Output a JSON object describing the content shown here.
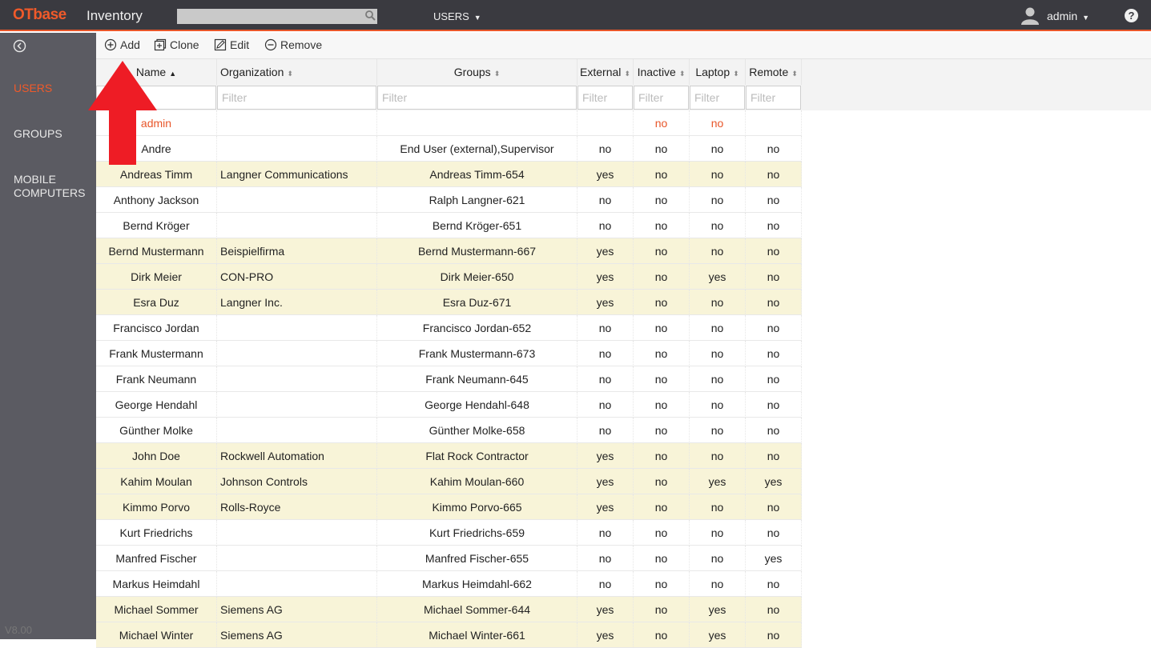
{
  "header": {
    "brand_ot": "OT",
    "brand_base": "base",
    "app_title": "Inventory",
    "search_placeholder": "",
    "menu_label": "USERS",
    "user_label": "admin",
    "help_label": "?"
  },
  "sidebar": {
    "items": [
      {
        "label": "USERS",
        "active": true
      },
      {
        "label": "GROUPS",
        "active": false
      },
      {
        "label": "MOBILE\nCOMPUTERS",
        "active": false
      }
    ],
    "version": "V8.00"
  },
  "toolbar": {
    "add": "Add",
    "clone": "Clone",
    "edit": "Edit",
    "remove": "Remove"
  },
  "table": {
    "columns": [
      {
        "label": "Name",
        "sort": "asc"
      },
      {
        "label": "Organization",
        "sort": "none"
      },
      {
        "label": "Groups",
        "sort": "none"
      },
      {
        "label": "External",
        "sort": "none"
      },
      {
        "label": "Inactive",
        "sort": "none"
      },
      {
        "label": "Laptop",
        "sort": "none"
      },
      {
        "label": "Remote",
        "sort": "none"
      }
    ],
    "filter_placeholder": "Filter",
    "rows": [
      {
        "name": "admin",
        "org": "",
        "groups": "",
        "external": "",
        "inactive": "no",
        "laptop": "no",
        "remote": "",
        "highlight": "red"
      },
      {
        "name": "Andre",
        "org": "",
        "groups": "End User (external),Supervisor",
        "external": "no",
        "inactive": "no",
        "laptop": "no",
        "remote": "no"
      },
      {
        "name": "Andreas Timm",
        "org": "Langner Communications",
        "groups": "Andreas Timm-654",
        "external": "yes",
        "inactive": "no",
        "laptop": "no",
        "remote": "no"
      },
      {
        "name": "Anthony Jackson",
        "org": "",
        "groups": "Ralph Langner-621",
        "external": "no",
        "inactive": "no",
        "laptop": "no",
        "remote": "no"
      },
      {
        "name": "Bernd Kröger",
        "org": "",
        "groups": "Bernd Kröger-651",
        "external": "no",
        "inactive": "no",
        "laptop": "no",
        "remote": "no"
      },
      {
        "name": "Bernd Mustermann",
        "org": "Beispielfirma",
        "groups": "Bernd Mustermann-667",
        "external": "yes",
        "inactive": "no",
        "laptop": "no",
        "remote": "no"
      },
      {
        "name": "Dirk Meier",
        "org": "CON-PRO",
        "groups": "Dirk Meier-650",
        "external": "yes",
        "inactive": "no",
        "laptop": "yes",
        "remote": "no"
      },
      {
        "name": "Esra Duz",
        "org": "Langner Inc.",
        "groups": "Esra Duz-671",
        "external": "yes",
        "inactive": "no",
        "laptop": "no",
        "remote": "no"
      },
      {
        "name": "Francisco Jordan",
        "org": "",
        "groups": "Francisco Jordan-652",
        "external": "no",
        "inactive": "no",
        "laptop": "no",
        "remote": "no"
      },
      {
        "name": "Frank Mustermann",
        "org": "",
        "groups": "Frank Mustermann-673",
        "external": "no",
        "inactive": "no",
        "laptop": "no",
        "remote": "no"
      },
      {
        "name": "Frank Neumann",
        "org": "",
        "groups": "Frank Neumann-645",
        "external": "no",
        "inactive": "no",
        "laptop": "no",
        "remote": "no"
      },
      {
        "name": "George Hendahl",
        "org": "",
        "groups": "George Hendahl-648",
        "external": "no",
        "inactive": "no",
        "laptop": "no",
        "remote": "no"
      },
      {
        "name": "Günther Molke",
        "org": "",
        "groups": "Günther Molke-658",
        "external": "no",
        "inactive": "no",
        "laptop": "no",
        "remote": "no"
      },
      {
        "name": "John Doe",
        "org": "Rockwell Automation",
        "groups": "Flat Rock Contractor",
        "external": "yes",
        "inactive": "no",
        "laptop": "no",
        "remote": "no"
      },
      {
        "name": "Kahim Moulan",
        "org": "Johnson Controls",
        "groups": "Kahim Moulan-660",
        "external": "yes",
        "inactive": "no",
        "laptop": "yes",
        "remote": "yes"
      },
      {
        "name": "Kimmo Porvo",
        "org": "Rolls-Royce",
        "groups": "Kimmo Porvo-665",
        "external": "yes",
        "inactive": "no",
        "laptop": "no",
        "remote": "no"
      },
      {
        "name": "Kurt Friedrichs",
        "org": "",
        "groups": "Kurt Friedrichs-659",
        "external": "no",
        "inactive": "no",
        "laptop": "no",
        "remote": "no"
      },
      {
        "name": "Manfred Fischer",
        "org": "",
        "groups": "Manfred Fischer-655",
        "external": "no",
        "inactive": "no",
        "laptop": "no",
        "remote": "yes"
      },
      {
        "name": "Markus Heimdahl",
        "org": "",
        "groups": "Markus Heimdahl-662",
        "external": "no",
        "inactive": "no",
        "laptop": "no",
        "remote": "no"
      },
      {
        "name": "Michael Sommer",
        "org": "Siemens AG",
        "groups": "Michael Sommer-644",
        "external": "yes",
        "inactive": "no",
        "laptop": "yes",
        "remote": "no"
      },
      {
        "name": "Michael Winter",
        "org": "Siemens AG",
        "groups": "Michael Winter-661",
        "external": "yes",
        "inactive": "no",
        "laptop": "yes",
        "remote": "no"
      }
    ]
  },
  "colors": {
    "accent": "#f05a2a",
    "topbar": "#3a3a40",
    "sidebar": "#5b5b62",
    "external_row": "#f8f4d8",
    "arrow": "#ee1c25"
  }
}
